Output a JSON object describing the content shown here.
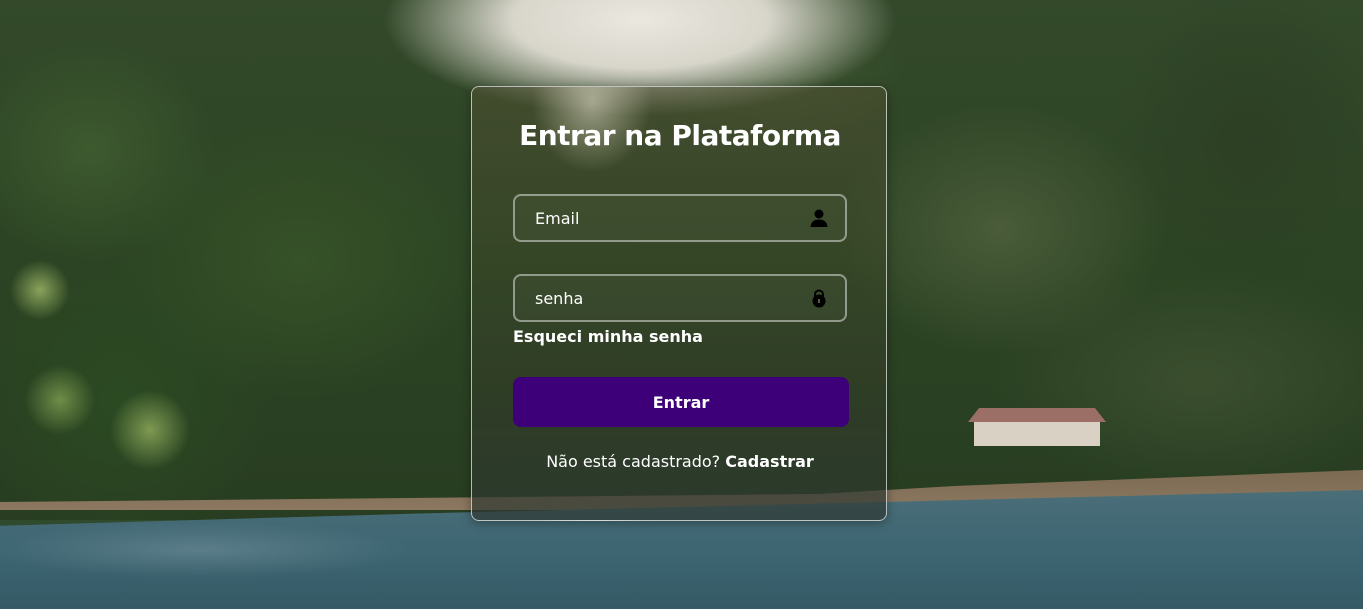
{
  "login": {
    "title": "Entrar na Plataforma",
    "email_placeholder": "Email",
    "email_value": "",
    "email_icon": "user-icon",
    "password_placeholder": "senha",
    "password_value": "",
    "password_icon": "lock-icon",
    "forgot_label": "Esqueci minha senha",
    "submit_label": "Entrar",
    "register_prompt": "Não está cadastrado?",
    "register_link": "Cadastrar"
  },
  "colors": {
    "button": "#3d0078",
    "text": "#ffffff",
    "card_border": "#ffffffa6"
  }
}
